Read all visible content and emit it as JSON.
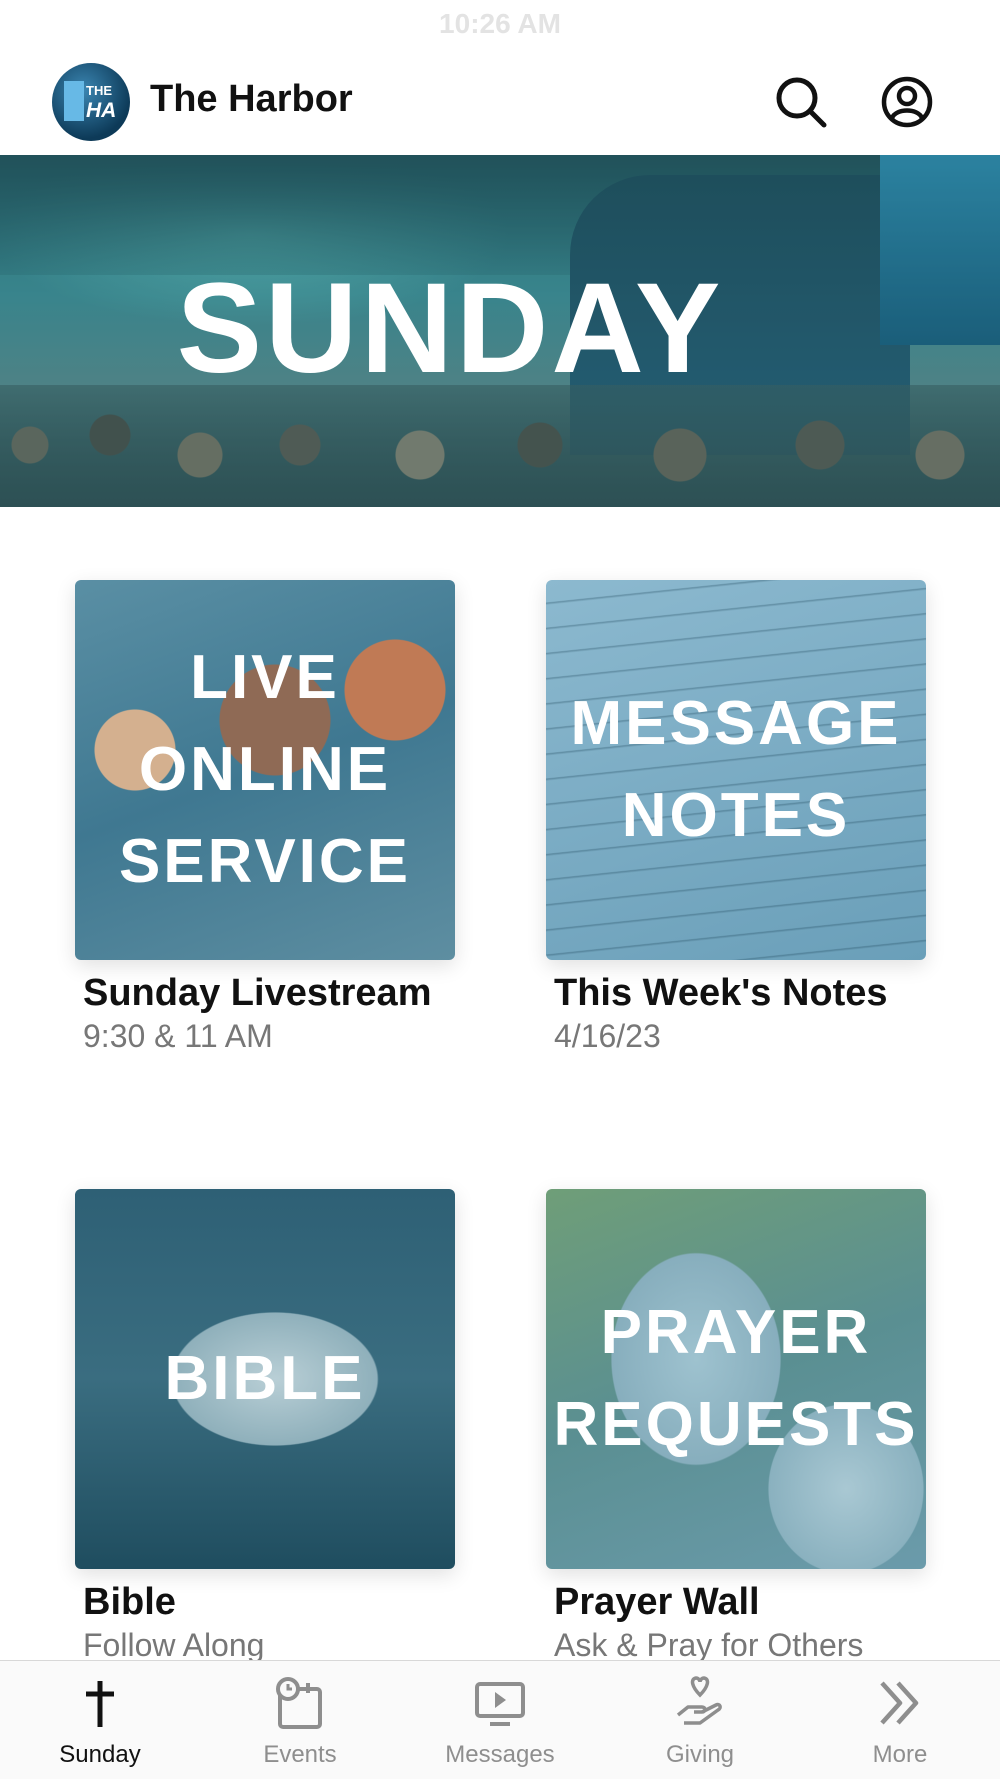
{
  "status_bar": {
    "time": "10:26 AM"
  },
  "header": {
    "logo_text": [
      "THE",
      "HA"
    ],
    "title": "The Harbor",
    "icons": [
      "search-icon",
      "account-icon"
    ]
  },
  "hero": {
    "title": "SUNDAY"
  },
  "cards": [
    {
      "overlay": "LIVE\nONLINE\nSERVICE",
      "title": "Sunday Livestream",
      "subtitle": "9:30 & 11 AM"
    },
    {
      "overlay": "MESSAGE\nNOTES",
      "title": "This Week's Notes",
      "subtitle": "4/16/23"
    },
    {
      "overlay": "BIBLE",
      "title": "Bible",
      "subtitle": "Follow Along"
    },
    {
      "overlay": "PRAYER\nREQUESTS",
      "title": "Prayer Wall",
      "subtitle": "Ask & Pray for Others"
    }
  ],
  "tabbar": {
    "active": "Sunday",
    "tabs": [
      {
        "label": "Sunday",
        "icon": "cross-icon"
      },
      {
        "label": "Events",
        "icon": "calendar-clock-icon"
      },
      {
        "label": "Messages",
        "icon": "video-icon"
      },
      {
        "label": "Giving",
        "icon": "giving-hand-icon"
      },
      {
        "label": "More",
        "icon": "double-chevron-icon"
      }
    ]
  },
  "colors": {
    "accent": "#111111",
    "inactive": "#8e8e8e",
    "tint": "#2f7f8f"
  }
}
